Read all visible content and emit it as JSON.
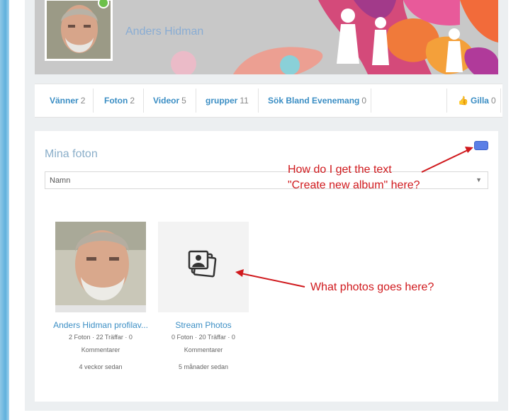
{
  "profile": {
    "name": "Anders Hidman"
  },
  "tabs": [
    {
      "label": "Vänner",
      "count": "2"
    },
    {
      "label": "Foton",
      "count": "2"
    },
    {
      "label": "Videor",
      "count": "5"
    },
    {
      "label": "grupper",
      "count": "11"
    },
    {
      "label": "Sök Bland Evenemang",
      "count": "0"
    }
  ],
  "like": {
    "label": "Gilla",
    "count": "0"
  },
  "photos": {
    "title": "Mina foton",
    "sort_value": "Namn",
    "albums": [
      {
        "name": "Anders Hidman profilav...",
        "meta_line1": "2 Foton · 22 Träffar · 0",
        "meta_line2": "Kommentarer",
        "date": "4 veckor sedan"
      },
      {
        "name": "Stream Photos",
        "meta_line1": "0 Foton · 20 Träffar · 0",
        "meta_line2": "Kommentarer",
        "date": "5 månader sedan"
      }
    ]
  },
  "annotations": {
    "create_album_line1": "How do I get the text",
    "create_album_line2": "\"Create new album\" here?",
    "stream_photos": "What photos goes here?"
  },
  "colors": {
    "link": "#3b8ec4",
    "annotation": "#d0191d",
    "button": "#5b7fe6",
    "online": "#6cc04a"
  }
}
